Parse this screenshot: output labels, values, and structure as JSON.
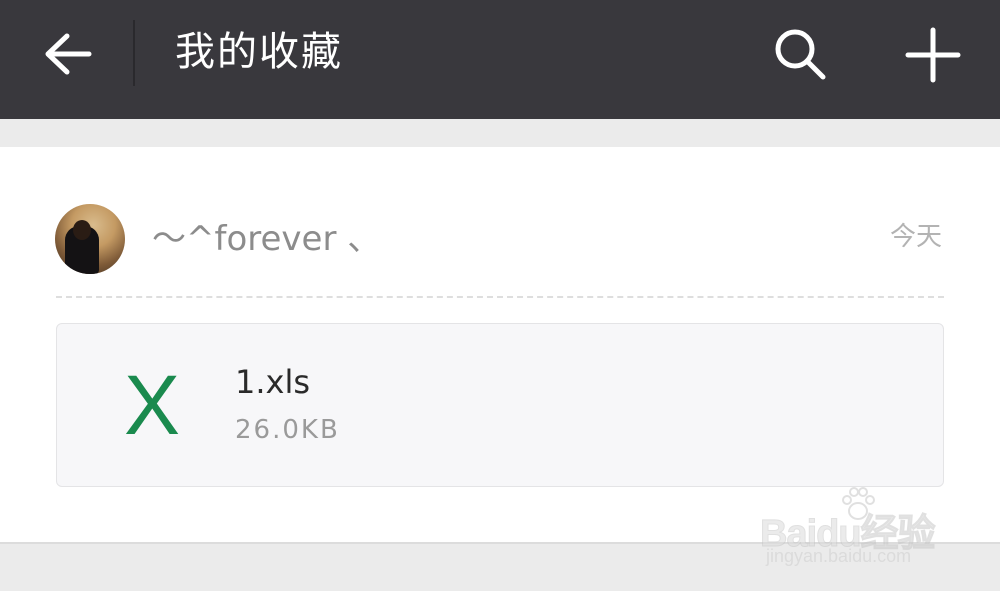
{
  "header": {
    "title": "我的收藏"
  },
  "favorite": {
    "username": "～^forever 、",
    "date": "今天",
    "file": {
      "name": "1.xls",
      "size": "26.0KB",
      "icon_letter": "X",
      "icon_color": "#1a8a4e"
    }
  },
  "watermark": {
    "logo": "Baidu经验",
    "url": "jingyan.baidu.com"
  },
  "colors": {
    "header_bg": "#39383d",
    "page_bg": "#ebebeb",
    "card_bg": "#ffffff"
  },
  "icons": {
    "back": "arrow-left-icon",
    "search": "search-icon",
    "add": "plus-icon"
  }
}
